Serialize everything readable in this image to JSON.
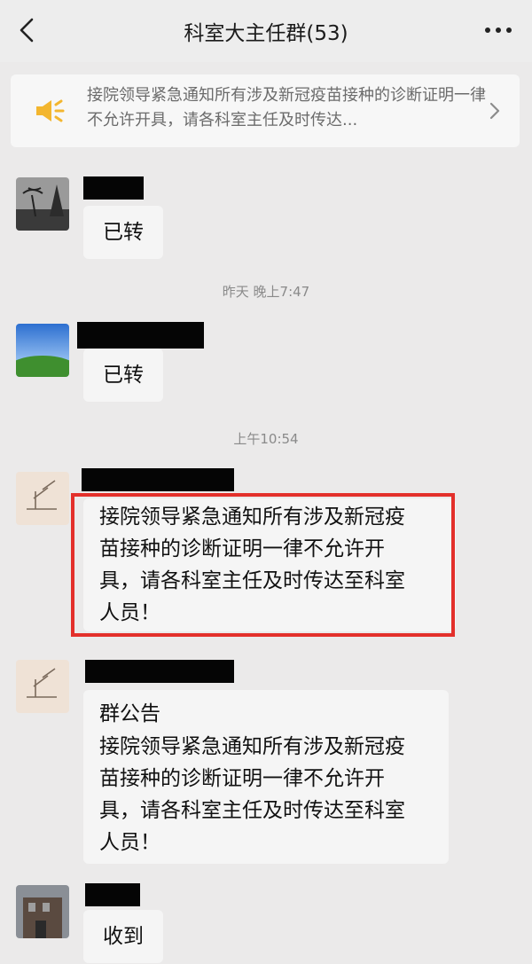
{
  "header": {
    "title": "科室大主任群(53)",
    "back_icon": "chevron-left-icon",
    "more_icon": "ellipsis-icon"
  },
  "announcement_bar": {
    "icon": "speaker-icon",
    "text": "接院领导紧急通知所有涉及新冠疫苗接种的诊断证明一律不允许开具，请各科室主任及时传达...",
    "chevron_icon": "chevron-right-icon"
  },
  "messages": [
    {
      "type": "message",
      "avatar": "palm-trees-photo",
      "text": "已转"
    },
    {
      "type": "time",
      "text": "昨天 晚上7:47"
    },
    {
      "type": "message",
      "avatar": "grass-field-photo",
      "text": "已转"
    },
    {
      "type": "time",
      "text": "上午10:54"
    },
    {
      "type": "message",
      "avatar": "sketch-drawing",
      "text": "接院领导紧急通知所有涉及新冠疫\n苗接种的诊断证明一律不允许开\n具，请各科室主任及时传达至科室\n人员！"
    },
    {
      "type": "message",
      "avatar": "sketch-drawing",
      "heading": "群公告",
      "text": "接院领导紧急通知所有涉及新冠疫\n苗接种的诊断证明一律不允许开\n具，请各科室主任及时传达至科室\n人员！"
    },
    {
      "type": "message",
      "avatar": "building-photo",
      "text": "收到"
    }
  ],
  "colors": {
    "highlight_border": "#e3302b",
    "bubble": "#f5f5f5",
    "background": "#ebeaea"
  }
}
